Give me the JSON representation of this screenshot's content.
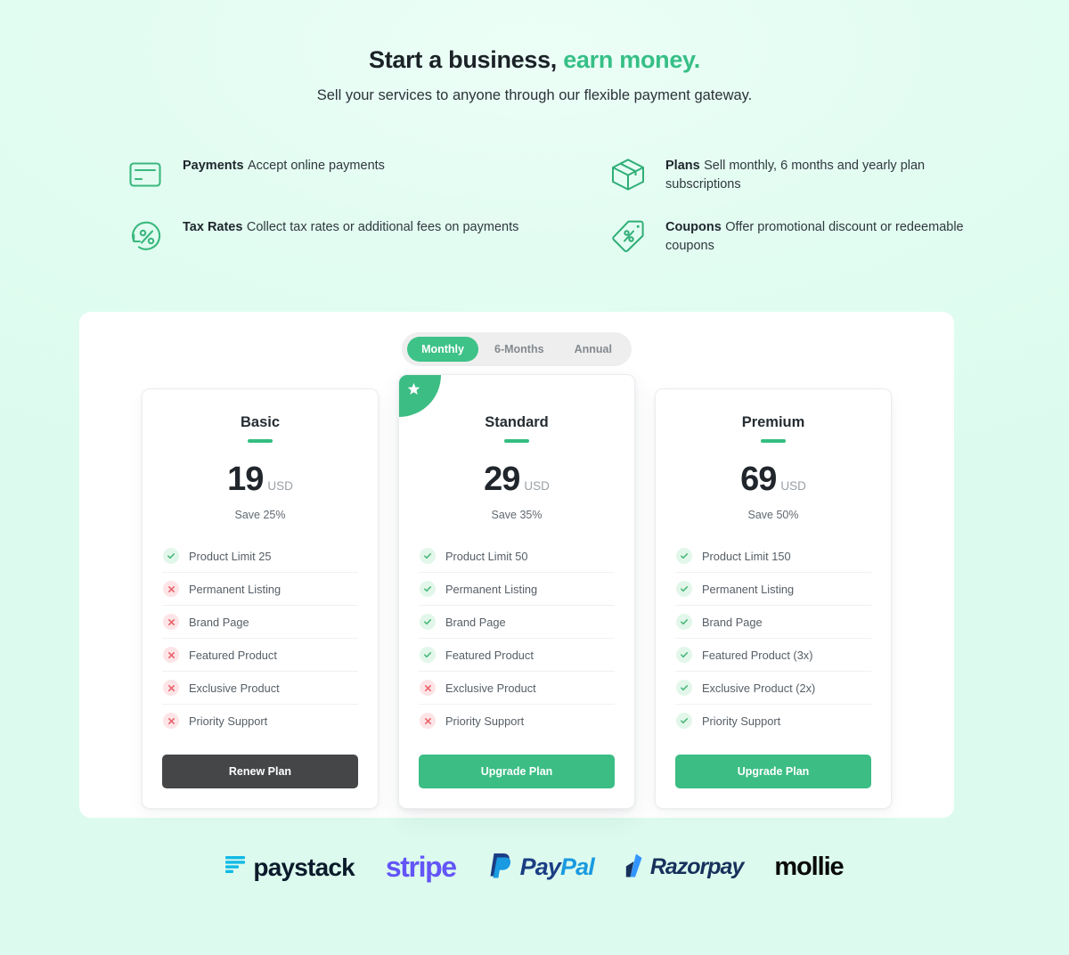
{
  "hero": {
    "title_main": "Start a business,",
    "title_accent": "earn money.",
    "subtitle": "Sell your services to anyone through our flexible payment gateway."
  },
  "features": [
    {
      "icon": "credit-card-icon",
      "title": "Payments",
      "desc": "Accept online payments"
    },
    {
      "icon": "box-icon",
      "title": "Plans",
      "desc": "Sell monthly, 6 months and yearly plan subscriptions"
    },
    {
      "icon": "percent-refresh-icon",
      "title": "Tax Rates",
      "desc": "Collect tax rates or additional fees on payments"
    },
    {
      "icon": "coupon-tag-icon",
      "title": "Coupons",
      "desc": "Offer promotional discount or redeemable coupons"
    }
  ],
  "billing_toggle": {
    "options": [
      "Monthly",
      "6-Months",
      "Annual"
    ],
    "selected": "Monthly"
  },
  "plans": [
    {
      "name": "Basic",
      "amount": "19",
      "currency": "USD",
      "save": "Save 25%",
      "featured": false,
      "badge_icon": "",
      "cta_label": "Renew Plan",
      "cta_style": "dark",
      "features": [
        {
          "label": "Product Limit 25",
          "included": true
        },
        {
          "label": "Permanent Listing",
          "included": false
        },
        {
          "label": "Brand Page",
          "included": false
        },
        {
          "label": "Featured Product",
          "included": false
        },
        {
          "label": "Exclusive Product",
          "included": false
        },
        {
          "label": "Priority Support",
          "included": false
        }
      ]
    },
    {
      "name": "Standard",
      "amount": "29",
      "currency": "USD",
      "save": "Save 35%",
      "featured": true,
      "badge_icon": "star-icon",
      "cta_label": "Upgrade Plan",
      "cta_style": "green",
      "features": [
        {
          "label": "Product Limit 50",
          "included": true
        },
        {
          "label": "Permanent Listing",
          "included": true
        },
        {
          "label": "Brand Page",
          "included": true
        },
        {
          "label": "Featured Product",
          "included": true
        },
        {
          "label": "Exclusive Product",
          "included": false
        },
        {
          "label": "Priority Support",
          "included": false
        }
      ]
    },
    {
      "name": "Premium",
      "amount": "69",
      "currency": "USD",
      "save": "Save 50%",
      "featured": false,
      "badge_icon": "",
      "cta_label": "Upgrade Plan",
      "cta_style": "green",
      "features": [
        {
          "label": "Product Limit 150",
          "included": true
        },
        {
          "label": "Permanent Listing",
          "included": true
        },
        {
          "label": "Brand Page",
          "included": true
        },
        {
          "label": "Featured Product (3x)",
          "included": true
        },
        {
          "label": "Exclusive Product (2x)",
          "included": true
        },
        {
          "label": "Priority Support",
          "included": true
        }
      ]
    }
  ],
  "payment_logos": [
    {
      "name": "paystack",
      "text": "paystack"
    },
    {
      "name": "stripe",
      "text": "stripe"
    },
    {
      "name": "paypal",
      "text_pay": "Pay",
      "text_pal": "Pal"
    },
    {
      "name": "razorpay",
      "text": "Razorpay"
    },
    {
      "name": "mollie",
      "text": "mollie"
    }
  ],
  "colors": {
    "accent_green": "#3bbd84",
    "background": "#dffbef",
    "dark_button": "#444648",
    "check_green": "#4cb97c",
    "cross_red": "#e8646d"
  }
}
